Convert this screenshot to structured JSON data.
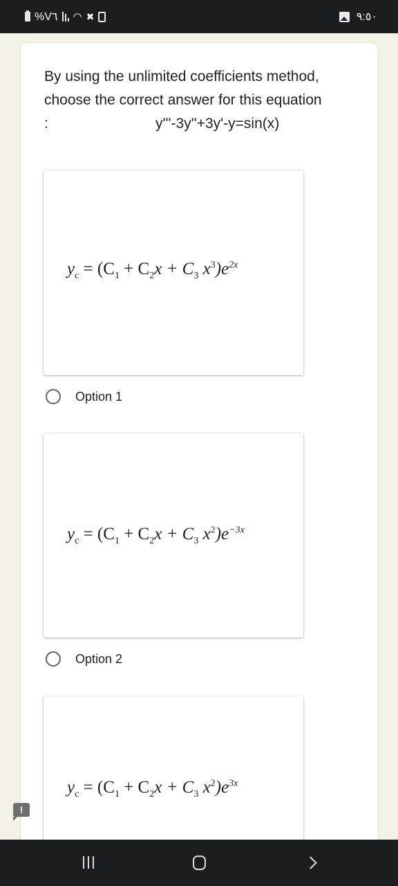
{
  "status_bar": {
    "battery_text": "%V٦",
    "time": "٩:٥٠",
    "icons": [
      "battery-icon",
      "signal-icon",
      "wifi-icon",
      "mute-icon",
      "security-icon",
      "image-notification-icon"
    ]
  },
  "question": {
    "line1": "By using the unlimited coefficients method,",
    "line2": "choose the correct answer for this equation",
    "colon": ":",
    "equation": "y'''-3y''+3y'-y=sin(x)"
  },
  "options": [
    {
      "label": "Option 1",
      "selected": false,
      "formula": {
        "lhs": "y",
        "lhs_sub": "c",
        "eq": " = (C",
        "c1": "1",
        "mid1": " + C",
        "c2": "2",
        "mid2": "x + C",
        "c3": "3",
        "mid3": " x",
        "pow": "3",
        "tail": ")e",
        "exp": "2x"
      }
    },
    {
      "label": "Option 2",
      "selected": false,
      "formula": {
        "lhs": "y",
        "lhs_sub": "c",
        "eq": " = (C",
        "c1": "1",
        "mid1": " + C",
        "c2": "2",
        "mid2": "x + C",
        "c3": "3",
        "mid3": " x",
        "pow": "2",
        "tail": ")e",
        "exp": "−3x"
      }
    },
    {
      "label": "",
      "selected": false,
      "formula": {
        "lhs": "y",
        "lhs_sub": "c",
        "eq": " = (C",
        "c1": "1",
        "mid1": " + C",
        "c2": "2",
        "mid2": "x + C",
        "c3": "3",
        "mid3": " x",
        "pow": "2",
        "tail": ")e",
        "exp": "3x"
      }
    }
  ],
  "feedback_button": {
    "glyph": "!"
  },
  "nav_bar": {
    "buttons": [
      "recents",
      "home",
      "back"
    ]
  }
}
